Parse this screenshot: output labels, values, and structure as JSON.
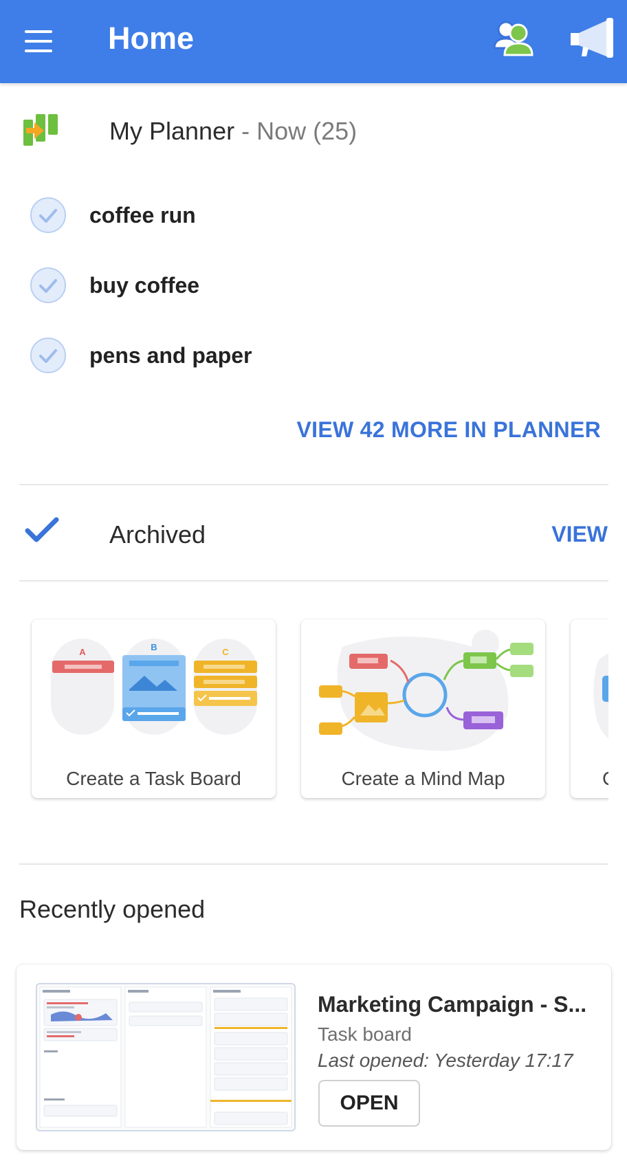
{
  "appbar": {
    "title": "Home",
    "color": "#3f7ee8",
    "icons": [
      "menu-icon",
      "people-icon",
      "megaphone-icon"
    ]
  },
  "planner": {
    "title": "My Planner",
    "separator": " - ",
    "subtitle": "Now (25)",
    "tasks": [
      {
        "label": "coffee run"
      },
      {
        "label": "buy coffee"
      },
      {
        "label": "pens and paper"
      }
    ],
    "view_more_label": "VIEW 42 MORE IN PLANNER"
  },
  "archived": {
    "label": "Archived",
    "view_label": "VIEW"
  },
  "templates": [
    {
      "label": "Create a Task Board",
      "icon": "task-board-illustration"
    },
    {
      "label": "Create a Mind Map",
      "icon": "mind-map-illustration"
    },
    {
      "label": "C",
      "icon": "partial-template-illustration"
    }
  ],
  "recent": {
    "heading": "Recently opened",
    "item": {
      "title": "Marketing Campaign - S...",
      "type": "Task board",
      "last_opened": "Last opened: Yesterday 17:17",
      "open_label": "OPEN"
    }
  },
  "colors": {
    "accent": "#3a73d9",
    "check_fill": "#e3ecfb"
  }
}
